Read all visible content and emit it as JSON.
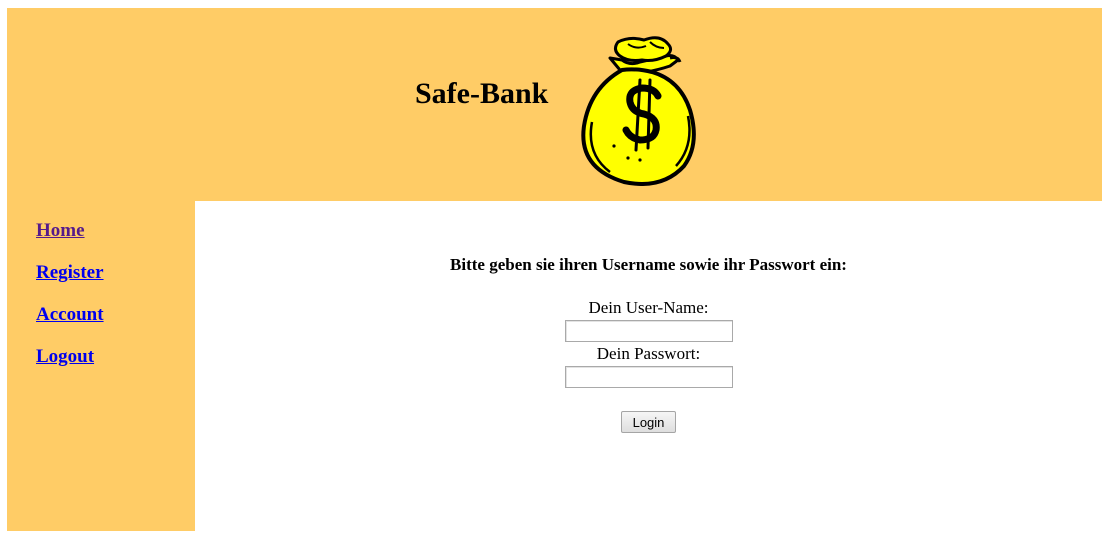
{
  "header": {
    "title": "Safe-Bank",
    "logo_icon": "money-bag-icon",
    "background_color": "#FFCC66"
  },
  "sidebar": {
    "items": [
      {
        "label": "Home",
        "visited": true
      },
      {
        "label": "Register",
        "visited": false
      },
      {
        "label": "Account",
        "visited": false
      },
      {
        "label": "Logout",
        "visited": false
      }
    ]
  },
  "login_form": {
    "prompt": "Bitte geben sie ihren Username sowie ihr Passwort ein:",
    "username_label": "Dein User-Name:",
    "username_value": "",
    "password_label": "Dein Passwort:",
    "password_value": "",
    "submit_label": "Login"
  }
}
